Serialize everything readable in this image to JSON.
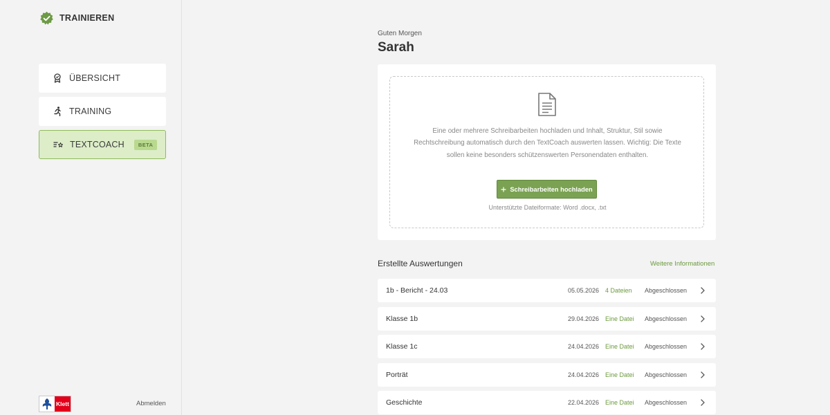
{
  "app": {
    "name": "TRAINIEREN"
  },
  "sidebar": {
    "items": [
      {
        "label": "ÜBERSICHT"
      },
      {
        "label": "TRAINING"
      },
      {
        "label": "TEXTCOACH",
        "badge": "BETA"
      }
    ],
    "logo_text": "Klett",
    "logout_label": "Abmelden"
  },
  "main": {
    "greeting": "Guten Morgen",
    "username": "Sarah",
    "upload": {
      "description": "Eine oder mehrere Schreibarbeiten hochladen und Inhalt, Struktur, Stil sowie Rechtschreibung automatisch durch den TextCoach auswerten lassen. Wichtig: Die Texte sollen keine besonders schützenswerten Personendaten enthalten.",
      "button_label": "Schreibarbeiten hochladen",
      "formats": "Unterstützte Dateiformate: Word .docx, .txt"
    },
    "evaluations": {
      "title": "Erstellte Auswertungen",
      "more_info": "Weitere Informationen",
      "rows": [
        {
          "name": "1b - Bericht - 24.03",
          "date": "05.05.2026",
          "files": "4 Dateien",
          "status": "Abgeschlossen"
        },
        {
          "name": "Klasse 1b",
          "date": "29.04.2026",
          "files": "Eine Datei",
          "status": "Abgeschlossen"
        },
        {
          "name": "Klasse 1c",
          "date": "24.04.2026",
          "files": "Eine Datei",
          "status": "Abgeschlossen"
        },
        {
          "name": "Porträt",
          "date": "24.04.2026",
          "files": "Eine Datei",
          "status": "Abgeschlossen"
        },
        {
          "name": "Geschichte",
          "date": "22.04.2026",
          "files": "Eine Datei",
          "status": "Abgeschlossen"
        }
      ]
    }
  },
  "colors": {
    "accent": "#7aa252",
    "accent_text": "#6b9a3e",
    "active_bg": "#dcedc8",
    "klett_red": "#e2001a"
  },
  "icons": {
    "brand": "check-badge-icon",
    "overview": "award-icon",
    "training": "running-person-icon",
    "textcoach": "list-star-icon",
    "upload": "document-icon",
    "button": "plus-icon",
    "row": "chevron-right-icon"
  }
}
